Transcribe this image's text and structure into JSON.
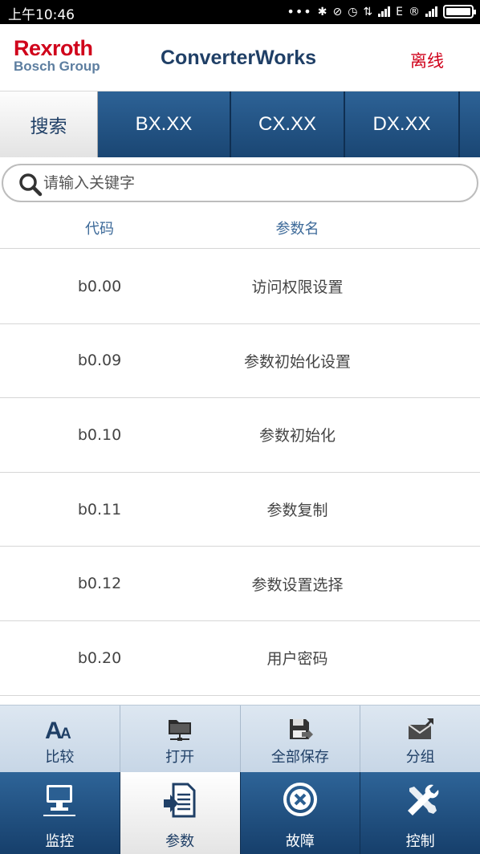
{
  "status_bar": {
    "time": "上午10:46",
    "network_label": "E"
  },
  "header": {
    "logo_main": "Rexroth",
    "logo_sub": "Bosch Group",
    "title": "ConverterWorks",
    "connection_status": "离线"
  },
  "tabs": [
    {
      "label": "搜索",
      "active": true
    },
    {
      "label": "BX.XX",
      "active": false
    },
    {
      "label": "CX.XX",
      "active": false
    },
    {
      "label": "DX.XX",
      "active": false
    }
  ],
  "search": {
    "placeholder": "请输入关键字",
    "value": ""
  },
  "table": {
    "headers": {
      "code": "代码",
      "name": "参数名"
    },
    "rows": [
      {
        "code": "b0.00",
        "name": "访问权限设置"
      },
      {
        "code": "b0.09",
        "name": "参数初始化设置"
      },
      {
        "code": "b0.10",
        "name": "参数初始化"
      },
      {
        "code": "b0.11",
        "name": "参数复制"
      },
      {
        "code": "b0.12",
        "name": "参数设置选择"
      },
      {
        "code": "b0.20",
        "name": "用户密码"
      }
    ]
  },
  "toolbar": [
    {
      "label": "比较",
      "icon": "compare-font-icon"
    },
    {
      "label": "打开",
      "icon": "folder-network-icon"
    },
    {
      "label": "全部保存",
      "icon": "save-all-icon"
    },
    {
      "label": "分组",
      "icon": "group-mail-icon"
    }
  ],
  "bottom_nav": [
    {
      "label": "监控",
      "icon": "monitor-icon",
      "active": false
    },
    {
      "label": "参数",
      "icon": "parameter-document-icon",
      "active": true
    },
    {
      "label": "故障",
      "icon": "fault-x-icon",
      "active": false
    },
    {
      "label": "控制",
      "icon": "tools-icon",
      "active": false
    }
  ],
  "colors": {
    "brand_red": "#d0021b",
    "brand_blue": "#1f3f66",
    "tab_blue": "#2d6296",
    "toolbar_light": "#dde7f1"
  }
}
